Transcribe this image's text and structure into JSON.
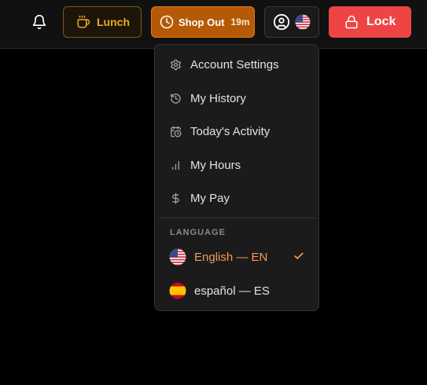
{
  "topbar": {
    "lunch_label": "Lunch",
    "shop_out_label": "Shop Out",
    "shop_out_duration": "19m",
    "lock_label": "Lock"
  },
  "menu": {
    "items": [
      {
        "label": "Account Settings",
        "icon": "gear-icon"
      },
      {
        "label": "My History",
        "icon": "history-icon"
      },
      {
        "label": "Today's Activity",
        "icon": "calendar-clock-icon"
      },
      {
        "label": "My Hours",
        "icon": "bar-chart-icon"
      },
      {
        "label": "My Pay",
        "icon": "dollar-icon"
      }
    ],
    "language_header": "LANGUAGE",
    "languages": [
      {
        "label": "English — EN",
        "flag": "us-flag-icon",
        "selected": true
      },
      {
        "label": "español — ES",
        "flag": "spain-flag-icon",
        "selected": false
      }
    ]
  },
  "colors": {
    "accent": "#f39a5a",
    "lock": "#ef4444",
    "shop_out": "#b45a06",
    "lunch_text": "#f0a822"
  }
}
